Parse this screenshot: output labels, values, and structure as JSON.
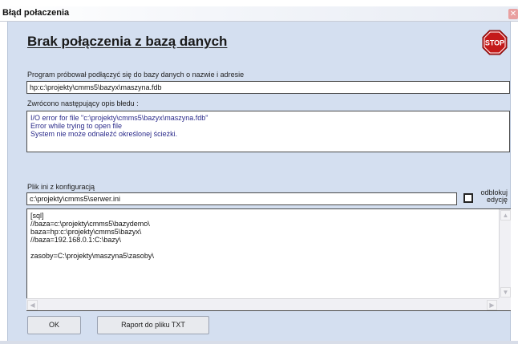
{
  "window": {
    "title": "Błąd połaczenia"
  },
  "header": {
    "title": "Brak połączenia z bazą danych",
    "stop_icon": "STOP"
  },
  "db": {
    "label": "Program próbował podłączyć się do bazy danych o nazwie i adresie",
    "value": "hp:c:\\projekty\\cmms5\\bazyx\\maszyna.fdb"
  },
  "error": {
    "label": "Zwrócono następujący opis błedu :",
    "lines": [
      "I/O error for file \"c:\\projekty\\cmms5\\bazyx\\maszyna.fdb\"",
      "Error while trying to open file",
      "System nie może odnaleźć określonej ścieżki."
    ]
  },
  "ini": {
    "label": "Plik ini z konfiguracją",
    "value": "c:\\projekty\\cmms5\\serwer.ini",
    "unlock_label_1": "odblokuj",
    "unlock_label_2": "edycję",
    "lines": [
      "[sql]",
      "//baza=c:\\projekty\\cmms5\\bazydemo\\",
      "baza=hp:c:\\projekty\\cmms5\\bazyx\\",
      "//baza=192.168.0.1:C:\\bazy\\",
      "",
      "zasoby=C:\\projekty\\maszyna5\\zasoby\\"
    ]
  },
  "buttons": {
    "ok": "OK",
    "report": "Raport do pliku TXT"
  },
  "colors": {
    "panel": "#d4dff0",
    "stop_red": "#c41a1a",
    "error_text": "#2a2a8a"
  }
}
